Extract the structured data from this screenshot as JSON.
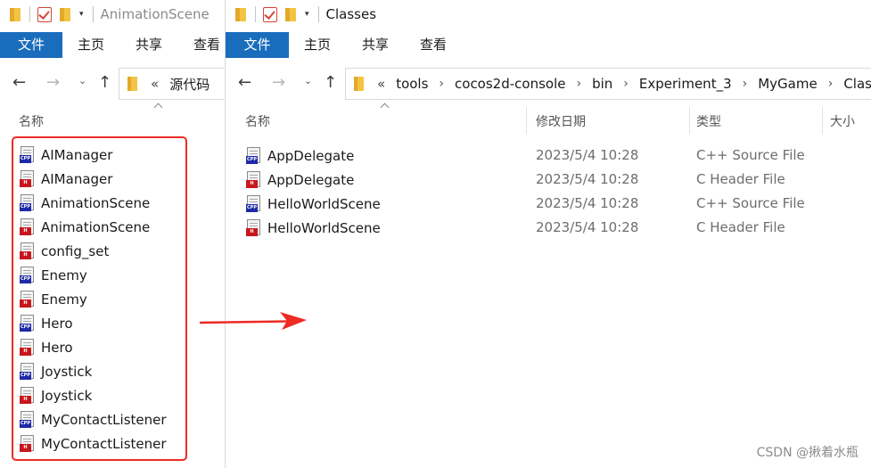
{
  "left_window": {
    "title": "AnimationScene",
    "ribbon_tabs": [
      "文件",
      "主页",
      "共享",
      "查看"
    ],
    "address": {
      "chevron": "«",
      "crumbs": [
        "源代码"
      ]
    },
    "columns": {
      "name": "名称"
    },
    "files": [
      {
        "name": "AIManager",
        "type": "cpp"
      },
      {
        "name": "AIManager",
        "type": "h"
      },
      {
        "name": "AnimationScene",
        "type": "cpp"
      },
      {
        "name": "AnimationScene",
        "type": "h"
      },
      {
        "name": "config_set",
        "type": "h"
      },
      {
        "name": "Enemy",
        "type": "cpp"
      },
      {
        "name": "Enemy",
        "type": "h"
      },
      {
        "name": "Hero",
        "type": "cpp"
      },
      {
        "name": "Hero",
        "type": "h"
      },
      {
        "name": "Joystick",
        "type": "cpp"
      },
      {
        "name": "Joystick",
        "type": "h"
      },
      {
        "name": "MyContactListener",
        "type": "cpp"
      },
      {
        "name": "MyContactListener",
        "type": "h"
      }
    ]
  },
  "right_window": {
    "title": "Classes",
    "ribbon_tabs": [
      "文件",
      "主页",
      "共享",
      "查看"
    ],
    "address": {
      "chevron": "«",
      "crumbs": [
        "tools",
        "cocos2d-console",
        "bin",
        "Experiment_3",
        "MyGame",
        "Classes"
      ]
    },
    "columns": {
      "name": "名称",
      "modified": "修改日期",
      "type": "类型",
      "size": "大小"
    },
    "files": [
      {
        "name": "AppDelegate",
        "modified": "2023/5/4 10:28",
        "type_label": "C++ Source File",
        "type": "cpp"
      },
      {
        "name": "AppDelegate",
        "modified": "2023/5/4 10:28",
        "type_label": "C Header File",
        "type": "h"
      },
      {
        "name": "HelloWorldScene",
        "modified": "2023/5/4 10:28",
        "type_label": "C++ Source File",
        "type": "cpp"
      },
      {
        "name": "HelloWorldScene",
        "modified": "2023/5/4 10:28",
        "type_label": "C Header File",
        "type": "h"
      }
    ]
  },
  "icon_labels": {
    "cpp": "CPP",
    "h": "H"
  },
  "icons": {
    "back": "←",
    "forward": "→",
    "recent": "⌄",
    "up": "↑",
    "crumb_separator": "›",
    "dropdown": "▾"
  },
  "annotations": {
    "highlight_color": "#ee2a24",
    "arrow_color": "#ee2a24"
  },
  "watermark": "CSDN @揪着水瓶"
}
